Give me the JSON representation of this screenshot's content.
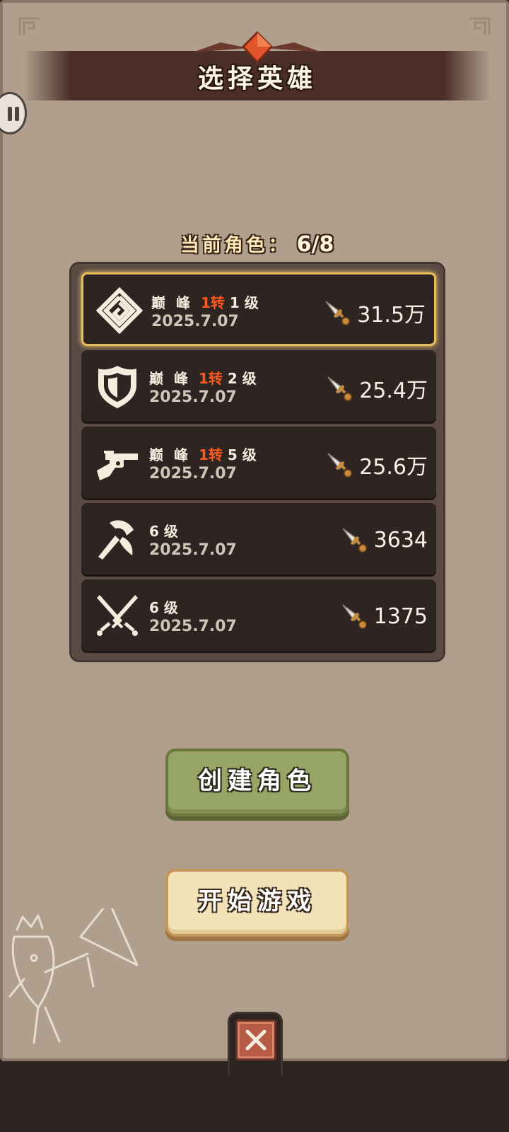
{
  "header": {
    "title": "选择英雄"
  },
  "roster": {
    "label": "当前角色：",
    "count": "6/8"
  },
  "heroes": [
    {
      "icon": "spiral-emblem-icon",
      "prefix": "巅 峰 ",
      "rebirth": "1转",
      "level": " 1 ",
      "level_unit": "级",
      "date": "2025.7.07",
      "power": "31.5万",
      "selected": true
    },
    {
      "icon": "shield-icon",
      "prefix": "巅 峰 ",
      "rebirth": "1转",
      "level": " 2 ",
      "level_unit": "级",
      "date": "2025.7.07",
      "power": "25.4万",
      "selected": false
    },
    {
      "icon": "revolver-icon",
      "prefix": "巅 峰 ",
      "rebirth": "1转",
      "level": " 5 ",
      "level_unit": "级",
      "date": "2025.7.07",
      "power": "25.6万",
      "selected": false
    },
    {
      "icon": "axe-icon",
      "prefix": "",
      "rebirth": "",
      "level": "6 ",
      "level_unit": "级",
      "date": "2025.7.07",
      "power": "3634",
      "selected": false
    },
    {
      "icon": "crossed-swords-icon",
      "prefix": "",
      "rebirth": "",
      "level": "6 ",
      "level_unit": "级",
      "date": "2025.7.07",
      "power": "1375",
      "selected": false
    }
  ],
  "actions": {
    "create_label": "创建角色",
    "start_label": "开始游戏"
  },
  "colors": {
    "panel": "#b09f8c",
    "row_bg": "#2e2523",
    "selected_border": "#e8bc5a",
    "rebirth_red": "#ff5a1e",
    "create_green": "#97a565",
    "start_cream": "#f2e2b8"
  }
}
